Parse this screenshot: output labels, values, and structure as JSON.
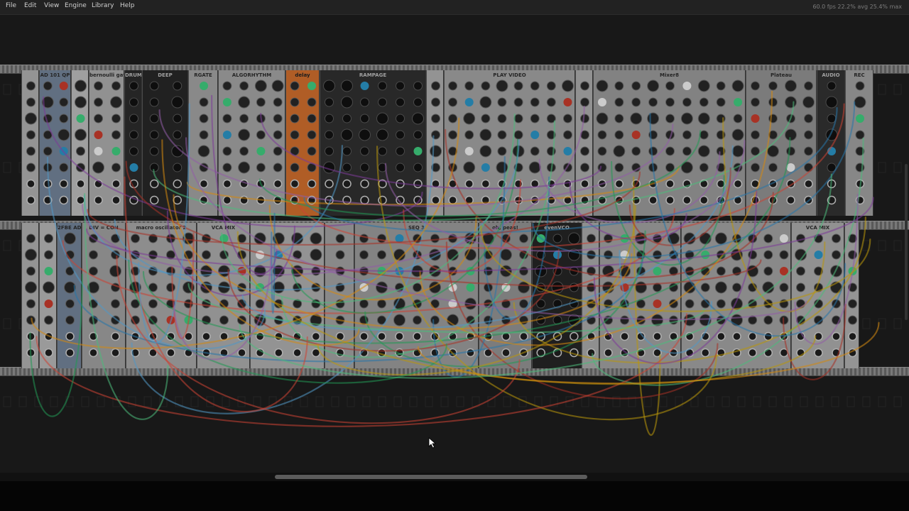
{
  "menu": [
    "File",
    "Edit",
    "View",
    "Engine",
    "Library",
    "Help"
  ],
  "stats": "60.0 fps  22.2% avg  25.4% max",
  "rack_rows": [
    [
      {
        "title": "",
        "w": 25,
        "bg": "#a9a9a9"
      },
      {
        "title": "AD 101 QP",
        "w": 45,
        "bg": "#6f7f93"
      },
      {
        "title": "",
        "w": 25,
        "bg": "#b5b5b5"
      },
      {
        "title": "bernoulli gate",
        "w": 50,
        "bg": "#a6a6a6"
      },
      {
        "title": "DRUMS",
        "w": 25,
        "bg": "#2b2b2b",
        "dark": true
      },
      {
        "title": "DEEP",
        "w": 65,
        "bg": "#262626",
        "dark": true
      },
      {
        "title": "RGATE",
        "w": 42,
        "bg": "#9d9d9d"
      },
      {
        "title": "ALGORHYTHM",
        "w": 95,
        "bg": "#9e9e9e"
      },
      {
        "title": "delay",
        "w": 48,
        "bg": "#c96a2c",
        "orange": true
      },
      {
        "title": "RAMPAGE",
        "w": 150,
        "bg": "#2e2e2e",
        "dark": true
      },
      {
        "title": "",
        "w": 25,
        "bg": "#a8a8a8"
      },
      {
        "title": "PLAY VIDEO",
        "w": 185,
        "bg": "#9c9c9c"
      },
      {
        "title": "",
        "w": 25,
        "bg": "#a5a5a5"
      },
      {
        "title": "Mixer8",
        "w": 215,
        "bg": "#959595"
      },
      {
        "title": "Plateau",
        "w": 100,
        "bg": "#8c8c8c"
      },
      {
        "title": "AUDIO",
        "w": 40,
        "bg": "#303030",
        "dark": true
      },
      {
        "title": "REC",
        "w": 40,
        "bg": "#9a9a9a"
      }
    ],
    [
      {
        "title": "",
        "w": 25,
        "bg": "#a9a9a9"
      },
      {
        "title": "",
        "w": 25,
        "bg": "#b0b0b0"
      },
      {
        "title": "2FBE AD",
        "w": 35,
        "bg": "#6f7f93"
      },
      {
        "title": "DIV = CON",
        "w": 62,
        "bg": "#9a9a9a"
      },
      {
        "title": "macro oscillator 2",
        "w": 100,
        "bg": "#a1a1a1"
      },
      {
        "title": "VCA MIX",
        "w": 75,
        "bg": "#a5a5a5"
      },
      {
        "title": "",
        "w": 105,
        "bg": "#a8a8a8"
      },
      {
        "title": "",
        "w": 42,
        "bg": "#9d9d9d"
      },
      {
        "title": "SEQ 3",
        "w": 175,
        "bg": "#969696"
      },
      {
        "title": "oh, peas!",
        "w": 75,
        "bg": "#8e8e8e"
      },
      {
        "title": "evenVCO",
        "w": 70,
        "bg": "#242424",
        "dark": true
      },
      {
        "title": "",
        "w": 25,
        "bg": "#a3a3a3"
      },
      {
        "title": "",
        "w": 115,
        "bg": "#9b9b9b"
      },
      {
        "title": "",
        "w": 155,
        "bg": "#9c9c9c"
      },
      {
        "title": "VCA MIX",
        "w": 75,
        "bg": "#a5a5a5"
      },
      {
        "title": "",
        "w": 21,
        "bg": "#a9a9a9"
      }
    ]
  ],
  "cable_colors": [
    "#c0392b",
    "#2e86c1",
    "#d4ac0d",
    "#27ae60",
    "#8e44ad",
    "#e74c3c",
    "#5dade2",
    "#f39c12",
    "#58d68d",
    "#a569bd"
  ]
}
